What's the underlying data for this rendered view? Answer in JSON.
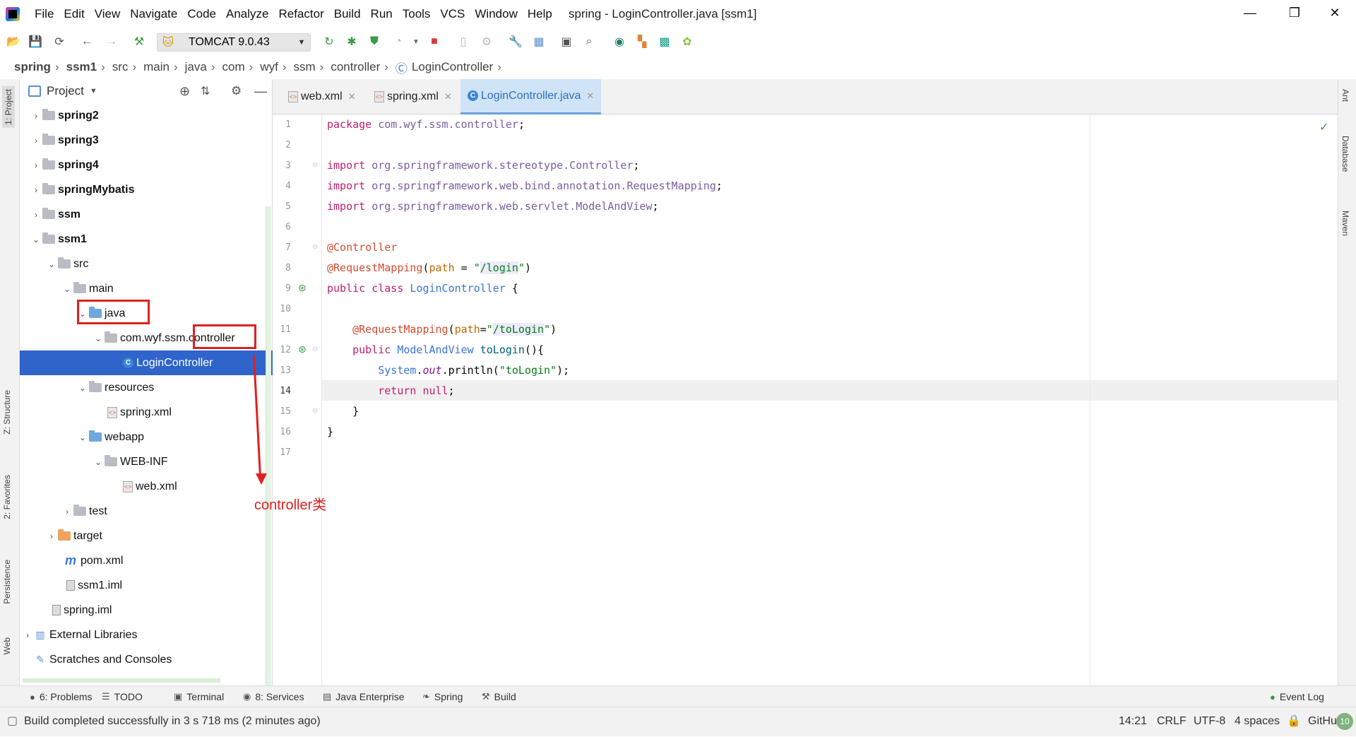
{
  "window": {
    "title": "spring - LoginController.java [ssm1]",
    "minimize": "—",
    "restore": "❐",
    "close": "✕"
  },
  "menu": [
    "File",
    "Edit",
    "View",
    "Navigate",
    "Code",
    "Analyze",
    "Refactor",
    "Build",
    "Run",
    "Tools",
    "VCS",
    "Window",
    "Help"
  ],
  "toolbar": {
    "run_config": "TOMCAT 9.0.43"
  },
  "breadcrumbs": [
    "spring",
    "ssm1",
    "src",
    "main",
    "java",
    "com",
    "wyf",
    "ssm",
    "controller",
    "LoginController"
  ],
  "left_stripe": [
    "1: Project",
    "Z: Structure",
    "2: Favorites",
    "Persistence",
    "Web"
  ],
  "right_stripe": [
    "Ant",
    "Database",
    "Maven"
  ],
  "project": {
    "header": "Project",
    "tree": [
      {
        "label": "spring2",
        "bold": true
      },
      {
        "label": "spring3",
        "bold": true
      },
      {
        "label": "spring4",
        "bold": true
      },
      {
        "label": "springMybatis",
        "bold": true
      },
      {
        "label": "ssm",
        "bold": true
      },
      {
        "label": "ssm1",
        "bold": true
      },
      {
        "label": "src"
      },
      {
        "label": "main"
      },
      {
        "label": "java"
      },
      {
        "label": "com.wyf.ssm.controller"
      },
      {
        "label": "LoginController"
      },
      {
        "label": "resources"
      },
      {
        "label": "spring.xml"
      },
      {
        "label": "webapp"
      },
      {
        "label": "WEB-INF"
      },
      {
        "label": "web.xml"
      },
      {
        "label": "test"
      },
      {
        "label": "target"
      },
      {
        "label": "pom.xml"
      },
      {
        "label": "ssm1.iml"
      },
      {
        "label": "spring.iml"
      },
      {
        "label": "External Libraries"
      },
      {
        "label": "Scratches and Consoles"
      }
    ]
  },
  "editor": {
    "tabs": [
      "web.xml",
      "spring.xml",
      "LoginController.java"
    ],
    "line_numbers": [
      "1",
      "2",
      "3",
      "4",
      "5",
      "6",
      "7",
      "8",
      "9",
      "10",
      "11",
      "12",
      "13",
      "14",
      "15",
      "16",
      "17"
    ],
    "current_line": "14"
  },
  "annotation": {
    "text": "controller类"
  },
  "tool_tabs": [
    "6: Problems",
    "TODO",
    "Terminal",
    "8: Services",
    "Java Enterprise",
    "Spring",
    "Build",
    "Event Log"
  ],
  "status": {
    "message": "Build completed successfully in 3 s 718 ms (2 minutes ago)",
    "position": "14:21",
    "line_sep": "CRLF",
    "encoding": "UTF-8",
    "indent": "4 spaces",
    "vcs": "GitHub",
    "badge": "10"
  }
}
